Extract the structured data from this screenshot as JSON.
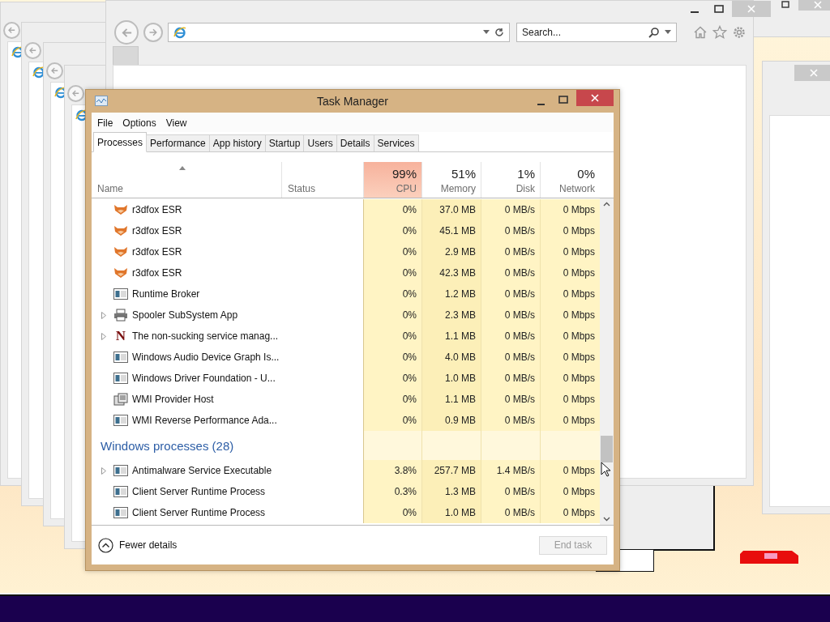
{
  "browser": {
    "search_placeholder": "Search..."
  },
  "task_manager": {
    "title": "Task Manager",
    "menu": [
      "File",
      "Options",
      "View"
    ],
    "tabs": [
      {
        "label": "Processes",
        "selected": true
      },
      {
        "label": "Performance",
        "selected": false
      },
      {
        "label": "App history",
        "selected": false
      },
      {
        "label": "Startup",
        "selected": false
      },
      {
        "label": "Users",
        "selected": false
      },
      {
        "label": "Details",
        "selected": false
      },
      {
        "label": "Services",
        "selected": false
      }
    ],
    "columns": [
      {
        "label": "Name",
        "sorted": true
      },
      {
        "label": "Status"
      },
      {
        "percent": "99%",
        "label": "CPU",
        "hot": true
      },
      {
        "percent": "51%",
        "label": "Memory",
        "hot": false
      },
      {
        "percent": "1%",
        "label": "Disk",
        "hot": false
      },
      {
        "percent": "0%",
        "label": "Network",
        "hot": false
      }
    ],
    "rows": [
      {
        "kind": "fox",
        "expandable": false,
        "name": "r3dfox ESR",
        "cells": [
          "0%",
          "37.0 MB",
          "0 MB/s",
          "0 Mbps"
        ]
      },
      {
        "kind": "fox",
        "expandable": false,
        "name": "r3dfox ESR",
        "cells": [
          "0%",
          "45.1 MB",
          "0 MB/s",
          "0 Mbps"
        ]
      },
      {
        "kind": "fox",
        "expandable": false,
        "name": "r3dfox ESR",
        "cells": [
          "0%",
          "2.9 MB",
          "0 MB/s",
          "0 Mbps"
        ]
      },
      {
        "kind": "fox",
        "expandable": false,
        "name": "r3dfox ESR",
        "cells": [
          "0%",
          "42.3 MB",
          "0 MB/s",
          "0 Mbps"
        ]
      },
      {
        "kind": "app",
        "expandable": false,
        "name": "Runtime Broker",
        "cells": [
          "0%",
          "1.2 MB",
          "0 MB/s",
          "0 Mbps"
        ]
      },
      {
        "kind": "printer",
        "expandable": true,
        "name": "Spooler SubSystem App",
        "cells": [
          "0%",
          "2.3 MB",
          "0 MB/s",
          "0 Mbps"
        ]
      },
      {
        "kind": "service",
        "icon_text": "N",
        "expandable": true,
        "name": "The non-sucking service manag...",
        "cells": [
          "0%",
          "1.1 MB",
          "0 MB/s",
          "0 Mbps"
        ]
      },
      {
        "kind": "app",
        "expandable": false,
        "name": "Windows Audio Device Graph Is...",
        "cells": [
          "0%",
          "4.0 MB",
          "0 MB/s",
          "0 Mbps"
        ]
      },
      {
        "kind": "app",
        "expandable": false,
        "name": "Windows Driver Foundation - U...",
        "cells": [
          "0%",
          "1.0 MB",
          "0 MB/s",
          "0 Mbps"
        ]
      },
      {
        "kind": "wmi",
        "expandable": false,
        "name": "WMI Provider Host",
        "cells": [
          "0%",
          "1.1 MB",
          "0 MB/s",
          "0 Mbps"
        ]
      },
      {
        "kind": "app",
        "expandable": false,
        "name": "WMI Reverse Performance Ada...",
        "cells": [
          "0%",
          "0.9 MB",
          "0 MB/s",
          "0 Mbps"
        ]
      },
      {
        "kind": "group",
        "name": "Windows processes (28)"
      },
      {
        "kind": "app",
        "expandable": true,
        "name": "Antimalware Service Executable",
        "cells": [
          "3.8%",
          "257.7 MB",
          "1.4 MB/s",
          "0 Mbps"
        ]
      },
      {
        "kind": "app",
        "expandable": false,
        "name": "Client Server Runtime Process",
        "cells": [
          "0.3%",
          "1.3 MB",
          "0 MB/s",
          "0 Mbps"
        ]
      },
      {
        "kind": "app",
        "expandable": false,
        "name": "Client Server Runtime Process",
        "cells": [
          "0%",
          "1.0 MB",
          "0 MB/s",
          "0 Mbps"
        ]
      }
    ],
    "footer": {
      "toggle": "Fewer details",
      "end_task": {
        "label": "End task",
        "disabled": true
      }
    }
  }
}
